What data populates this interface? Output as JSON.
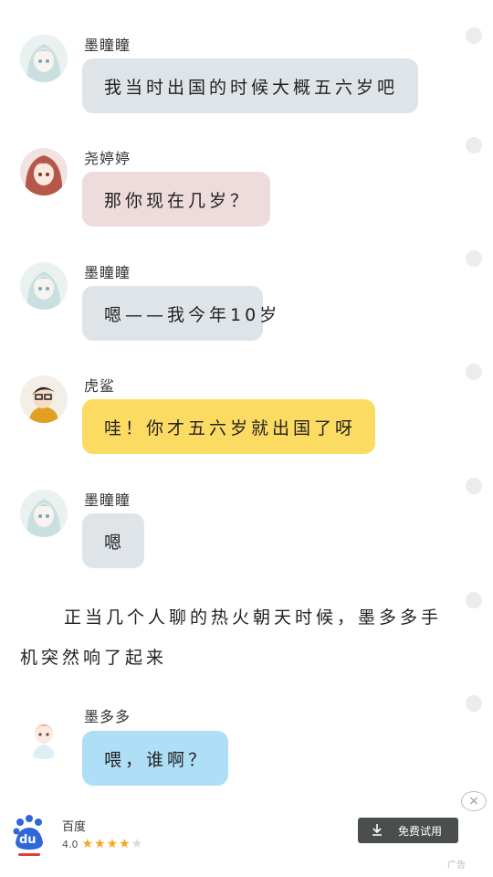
{
  "messages": [
    {
      "name": "墨瞳瞳",
      "text": "我当时出国的时候大概五六岁吧",
      "color": "#dfe4e9",
      "avatar": "anime-girl-avatar"
    },
    {
      "name": "尧婷婷",
      "text": "那你现在几岁？",
      "color": "#eedcdc",
      "avatar": "red-hair-girl-avatar"
    },
    {
      "name": "墨瞳瞳",
      "text": "嗯——我今年10岁",
      "color": "#dfe4e9",
      "avatar": "anime-girl-avatar"
    },
    {
      "name": "虎鲨",
      "text": "哇！你才五六岁就出国了呀",
      "color": "#fcdb62",
      "avatar": "boy-avatar"
    },
    {
      "name": "墨瞳瞳",
      "text": "嗯",
      "color": "#dfe4e9",
      "avatar": "anime-girl-avatar"
    },
    {
      "name": "墨多多",
      "text": "喂，谁啊？",
      "color": "#aedff7",
      "avatar": "boy-pink-hair-avatar"
    }
  ],
  "narration": "正当几个人聊的热火朝天时候，墨多多手机突然响了起来",
  "ad": {
    "title": "百度",
    "rating": "4.0",
    "logo_text": "du",
    "button_label": "免费试用",
    "close_icon": "×",
    "tag": "广告"
  }
}
